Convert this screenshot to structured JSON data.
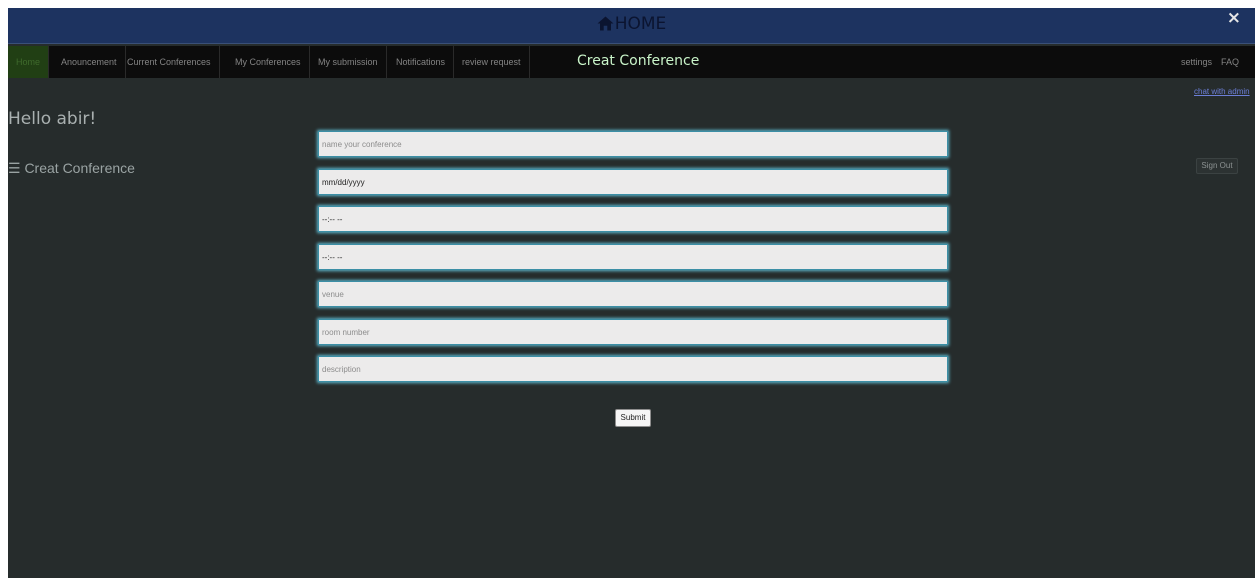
{
  "header": {
    "title": "HOME",
    "close_label": "×"
  },
  "nav": {
    "items": [
      {
        "label": "Home"
      },
      {
        "label": "Anouncement"
      },
      {
        "label": "Current Conferences"
      },
      {
        "label": "My Conferences"
      },
      {
        "label": "My submission"
      },
      {
        "label": "Notifications"
      },
      {
        "label": "review request"
      }
    ],
    "page_heading": "Creat Conference",
    "right_items": [
      {
        "label": "settings"
      },
      {
        "label": "FAQ"
      }
    ]
  },
  "chat_link": "chat with admin",
  "greeting": "Hello abir!",
  "sidebar_title": "☰ Creat Conference",
  "signout_label": "Sign Out",
  "form": {
    "name_placeholder": "name your conference",
    "date_value": "mm/dd/yyyy",
    "start_time_value": "--:-- --",
    "end_time_value": "--:-- --",
    "venue_placeholder": "venue",
    "room_placeholder": "room number",
    "description_placeholder": "description",
    "submit_label": "Submit"
  },
  "colors": {
    "header_bg": "#1d3360",
    "nav_bg": "#0c0c0c",
    "page_bg": "#262c2c",
    "field_glow": "#5eb6cc",
    "active_tab": "#213f14"
  }
}
